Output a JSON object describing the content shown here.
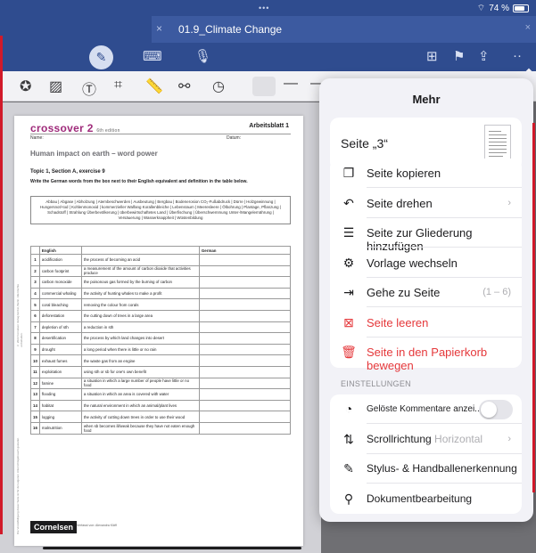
{
  "status": {
    "dots": "•••",
    "battery": "74 %"
  },
  "tab": {
    "title": "01.9_Climate Change",
    "close": "×"
  },
  "toolbar": {
    "pen_icon": "pen-icon",
    "keyboard_icon": "keyboard-icon",
    "mic_icon": "microphone-icon",
    "add_page_icon": "add-page-icon",
    "bookmark_icon": "bookmark-icon",
    "share_icon": "share-icon",
    "more": "··"
  },
  "document": {
    "brand": "crossover 2",
    "brand_sub": "6th edition",
    "sheet_label": "Arbeitsblatt 1",
    "name_label": "Name:",
    "date_label": "Datum:",
    "heading": "Human impact on earth – word power",
    "topic": "Topic 1, Section A, exercise 9",
    "instruction": "Write the German words from the box next to their English equivalent and definition in the table below.",
    "word_box": "Abbau | Abgase | Abholzung | Atembeschwerden | Ausbeutung | Bergbau | Bodenerosion CO₂-Fußabdruck | Dürre | Holzgewinnung | Hungersnot/-tod | Kohlenmonoxid | kommerzieller Walfang Korallenbleiche | Lebensraum | Meeresleere | Ölbohrung | Plantage, Pflanzung | Schadstoff | Strahlung Überbevölkerung | überbewirtschaftetes Land | Überfischung | Überschwemmung Unter-/Mangelernährung | Versäuerung | Wasserknappheit | Wüstenbildung",
    "columns": [
      "",
      "English",
      "",
      "German"
    ],
    "rows": [
      {
        "num": "1",
        "english": "acidification",
        "definition": "the process of becoming an acid"
      },
      {
        "num": "2",
        "english": "carbon footprint",
        "definition": "a measurement of the amount of carbon dioxide that activities produce"
      },
      {
        "num": "3",
        "english": "carbon monoxide",
        "definition": "the poisonous gas formed by the burning of carbon"
      },
      {
        "num": "4",
        "english": "commercial whaling",
        "definition": "the activity of hunting whales to make a profit"
      },
      {
        "num": "5",
        "english": "coral bleaching",
        "definition": "removing the colour from corals"
      },
      {
        "num": "6",
        "english": "deforestation",
        "definition": "the cutting down of trees in a large area"
      },
      {
        "num": "7",
        "english": "depletion of sth",
        "definition": "a reduction in sth"
      },
      {
        "num": "8",
        "english": "desertification",
        "definition": "the process by which land changes into desert"
      },
      {
        "num": "9",
        "english": "drought",
        "definition": "a long period when there is little or no rain"
      },
      {
        "num": "10",
        "english": "exhaust fumes",
        "definition": "the waste gas from an engine"
      },
      {
        "num": "11",
        "english": "exploitation",
        "definition": "using sth or sb for one's own benefit"
      },
      {
        "num": "12",
        "english": "famine",
        "definition": "a situation in which a large number of people have little or no food"
      },
      {
        "num": "13",
        "english": "flooding",
        "definition": "a situation in which an area is covered with water"
      },
      {
        "num": "14",
        "english": "habitat",
        "definition": "the natural environment in which an animal/plant lives"
      },
      {
        "num": "15",
        "english": "logging",
        "definition": "the activity of cutting down trees in order to use their wood"
      },
      {
        "num": "16",
        "english": "malnutrition",
        "definition": "when sb becomes ill/weak because they have not eaten enough food"
      }
    ],
    "publisher": "Cornelsen",
    "footer_note": "Verfasst von: Alexandra Kläff",
    "side_note_top": "© 2022 Cornelsen Verlag GmbH, Berlin. Alle Rechte vorbehalten.",
    "side_note_bottom": "Die Vervielfältigung dieser Seite ist für den eigenen Unterrichtsgebrauch gestattet."
  },
  "popover": {
    "title": "Mehr",
    "page_label": "Seite „3“",
    "actions": [
      {
        "icon": "copy-icon",
        "glyph": "❐",
        "label": "Seite kopieren",
        "aux": "",
        "red": false
      },
      {
        "icon": "rotate-icon",
        "glyph": "↶",
        "label": "Seite drehen",
        "aux": "›",
        "red": false
      },
      {
        "icon": "outline-icon",
        "glyph": "☰",
        "label": "Seite zur Gliederung hinzufügen",
        "aux": "",
        "red": false
      },
      {
        "icon": "template-icon",
        "glyph": "⚙",
        "label": "Vorlage wechseln",
        "aux": "",
        "red": false
      },
      {
        "icon": "goto-icon",
        "glyph": "⇥",
        "label": "Gehe zu Seite",
        "aux": "(1 – 6)",
        "red": false
      },
      {
        "icon": "clear-page-icon",
        "glyph": "⊠",
        "label": "Seite leeren",
        "aux": "",
        "red": true
      },
      {
        "icon": "trash-icon",
        "glyph": "🗑",
        "label": "Seite in den Papierkorb bewegen",
        "aux": "",
        "red": true
      }
    ],
    "settings_header": "EINSTELLUNGEN",
    "settings": [
      {
        "icon": "comment-icon",
        "glyph": "◔",
        "label": "Gelöste Kommentare anzei...",
        "value": ""
      },
      {
        "icon": "scroll-direction-icon",
        "glyph": "⇅",
        "label": "Scrollrichtung",
        "value": "Horizontal"
      },
      {
        "icon": "stylus-icon",
        "glyph": "✎",
        "label": "Stylus- & Handballenerkennung",
        "value": ""
      },
      {
        "icon": "document-editing-icon",
        "glyph": "⚲",
        "label": "Dokumentbearbeitung",
        "value": ""
      }
    ]
  }
}
